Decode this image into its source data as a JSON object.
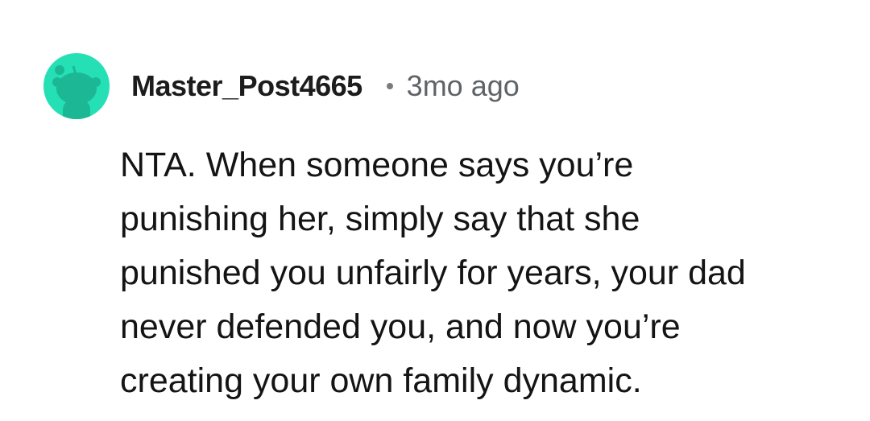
{
  "comment": {
    "author": "Master_Post4665",
    "separator_icon": "dot-separator",
    "timestamp": "3mo ago",
    "avatar_icon": "reddit-snoo-avatar-icon",
    "avatar_color": "#24e0b4",
    "body_lines": [
      "NTA. When someone says you’re",
      "punishing her, simply say that she",
      "punished you unfairly for years, your dad",
      "never defended you, and now you’re",
      "creating your own family dynamic."
    ]
  }
}
